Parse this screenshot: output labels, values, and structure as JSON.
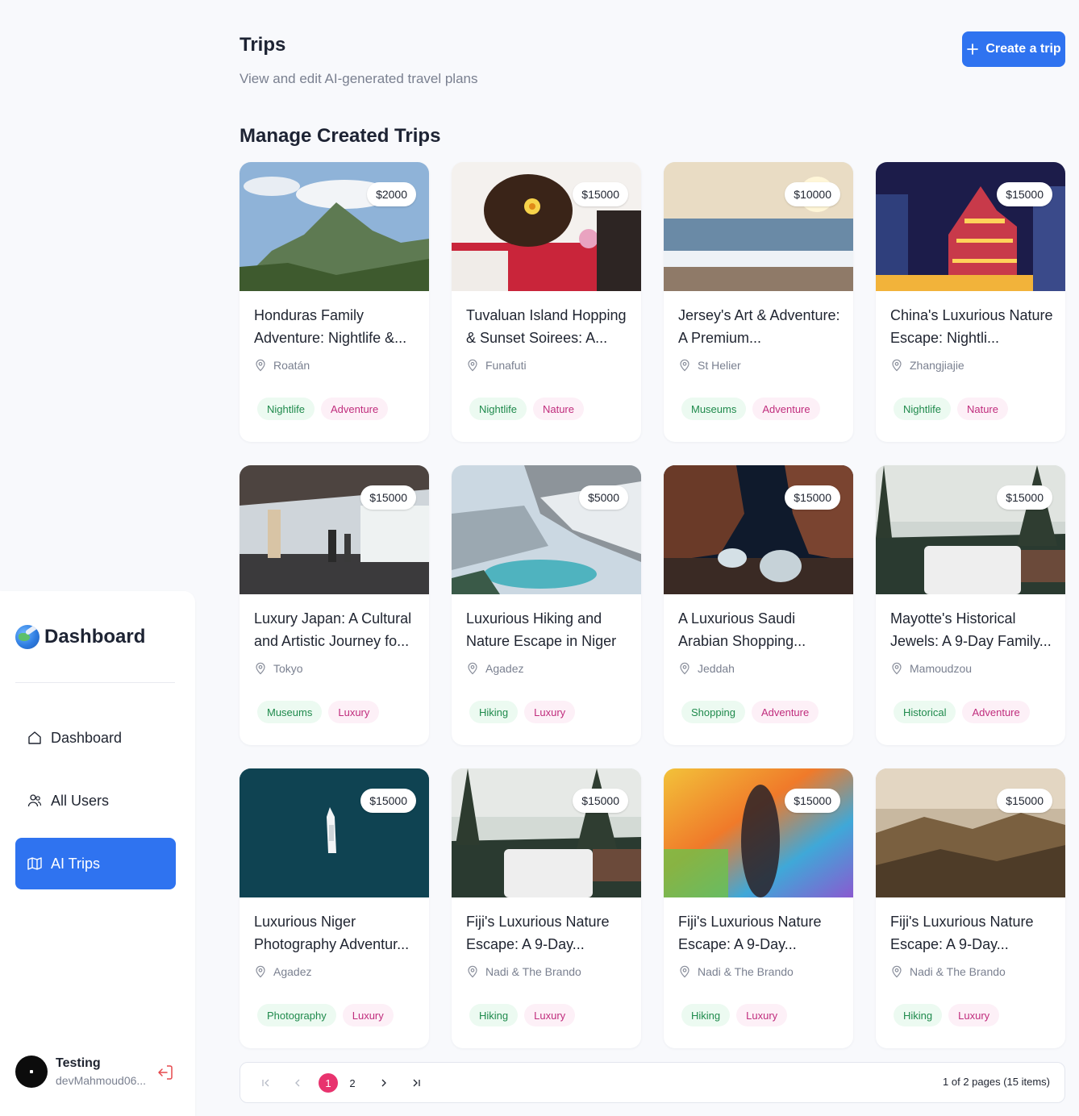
{
  "header": {
    "title": "Trips",
    "subtitle": "View and edit AI-generated travel plans",
    "create_button": "Create a trip",
    "section_title": "Manage Created Trips"
  },
  "sidebar": {
    "brand": "Dashboard",
    "items": [
      {
        "label": "Dashboard",
        "icon": "home-icon",
        "active": false
      },
      {
        "label": "All Users",
        "icon": "users-icon",
        "active": false
      },
      {
        "label": "AI Trips",
        "icon": "map-icon",
        "active": true
      }
    ],
    "user": {
      "name": "Testing",
      "email": "devMahmoud06..."
    }
  },
  "trips": [
    {
      "title": "Honduras Family Adventure: Nightlife &...",
      "location": "Roatán",
      "price": "$2000",
      "tags": [
        "Nightlife",
        "Adventure"
      ]
    },
    {
      "title": "Tuvaluan Island Hopping & Sunset Soirees: A...",
      "location": "Funafuti",
      "price": "$15000",
      "tags": [
        "Nightlife",
        "Nature"
      ]
    },
    {
      "title": "Jersey's Art & Adventure: A Premium...",
      "location": "St Helier",
      "price": "$10000",
      "tags": [
        "Museums",
        "Adventure"
      ]
    },
    {
      "title": "China's Luxurious Nature Escape: Nightli...",
      "location": "Zhangjiajie",
      "price": "$15000",
      "tags": [
        "Nightlife",
        "Nature"
      ]
    },
    {
      "title": "Luxury Japan: A Cultural and Artistic Journey fo...",
      "location": "Tokyo",
      "price": "$15000",
      "tags": [
        "Museums",
        "Luxury"
      ]
    },
    {
      "title": "Luxurious Hiking and Nature Escape in Niger",
      "location": "Agadez",
      "price": "$5000",
      "tags": [
        "Hiking",
        "Luxury"
      ]
    },
    {
      "title": "A Luxurious Saudi Arabian Shopping...",
      "location": "Jeddah",
      "price": "$15000",
      "tags": [
        "Shopping",
        "Adventure"
      ]
    },
    {
      "title": "Mayotte's Historical Jewels: A 9-Day Family...",
      "location": "Mamoudzou",
      "price": "$15000",
      "tags": [
        "Historical",
        "Adventure"
      ]
    },
    {
      "title": "Luxurious Niger Photography Adventur...",
      "location": "Agadez",
      "price": "$15000",
      "tags": [
        "Photography",
        "Luxury"
      ]
    },
    {
      "title": "Fiji's Luxurious Nature Escape: A 9-Day...",
      "location": "Nadi & The Brando",
      "price": "$15000",
      "tags": [
        "Hiking",
        "Luxury"
      ]
    },
    {
      "title": "Fiji's Luxurious Nature Escape: A 9-Day...",
      "location": "Nadi & The Brando",
      "price": "$15000",
      "tags": [
        "Hiking",
        "Luxury"
      ]
    },
    {
      "title": "Fiji's Luxurious Nature Escape: A 9-Day...",
      "location": "Nadi & The Brando",
      "price": "$15000",
      "tags": [
        "Hiking",
        "Luxury"
      ]
    }
  ],
  "pagination": {
    "pages": [
      "1",
      "2"
    ],
    "current": "1",
    "info": "1 of 2 pages (15 items)"
  },
  "colors": {
    "accent": "#2f73f0",
    "page_active": "#e8336e",
    "tag_green_text": "#1f8a4c",
    "tag_pink_text": "#c02d7d"
  }
}
